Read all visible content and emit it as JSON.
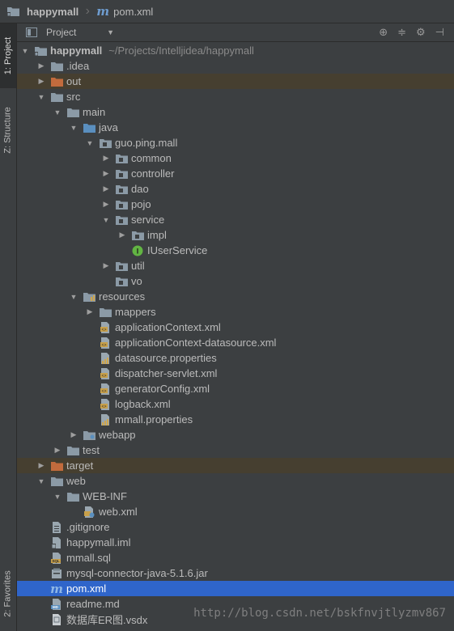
{
  "breadcrumb": {
    "project": "happymall",
    "file": "pom.xml"
  },
  "sidebar": {
    "project_tab": "1: Project",
    "structure_tab": "Z: Structure",
    "favorites_tab": "2: Favorites"
  },
  "panel": {
    "view_label": "Project"
  },
  "root": {
    "name": "happymall",
    "path": "~/Projects/Intelljidea/happymall"
  },
  "tree": {
    "idea": ".idea",
    "out": "out",
    "src": "src",
    "main": "main",
    "java": "java",
    "pkg": "guo.ping.mall",
    "common": "common",
    "controller": "controller",
    "dao": "dao",
    "pojo": "pojo",
    "service": "service",
    "impl": "impl",
    "iuserservice": "IUserService",
    "util": "util",
    "vo": "vo",
    "resources": "resources",
    "mappers": "mappers",
    "appctx": "applicationContext.xml",
    "appctx_ds": "applicationContext-datasource.xml",
    "ds_props": "datasource.properties",
    "dispatcher": "dispatcher-servlet.xml",
    "generator": "generatorConfig.xml",
    "logback": "logback.xml",
    "mmall_props": "mmall.properties",
    "webapp": "webapp",
    "test": "test",
    "target": "target",
    "web": "web",
    "webinf": "WEB-INF",
    "webxml": "web.xml",
    "gitignore": ".gitignore",
    "iml": "happymall.iml",
    "sql": "mmall.sql",
    "jar": "mysql-connector-java-5.1.6.jar",
    "pom": "pom.xml",
    "readme": "readme.md",
    "vsdx": "数据库ER图.vsdx"
  },
  "watermark": "http://blog.csdn.net/bskfnvjtlyzmv867",
  "colors": {
    "background": "#3c3f41",
    "selection": "#2f65ca",
    "excluded_row": "#463f30",
    "folder": "#8b9aa6",
    "excluded_folder": "#c26b3d",
    "maven_blue": "#6e9ccf",
    "interface_green": "#62b543"
  }
}
